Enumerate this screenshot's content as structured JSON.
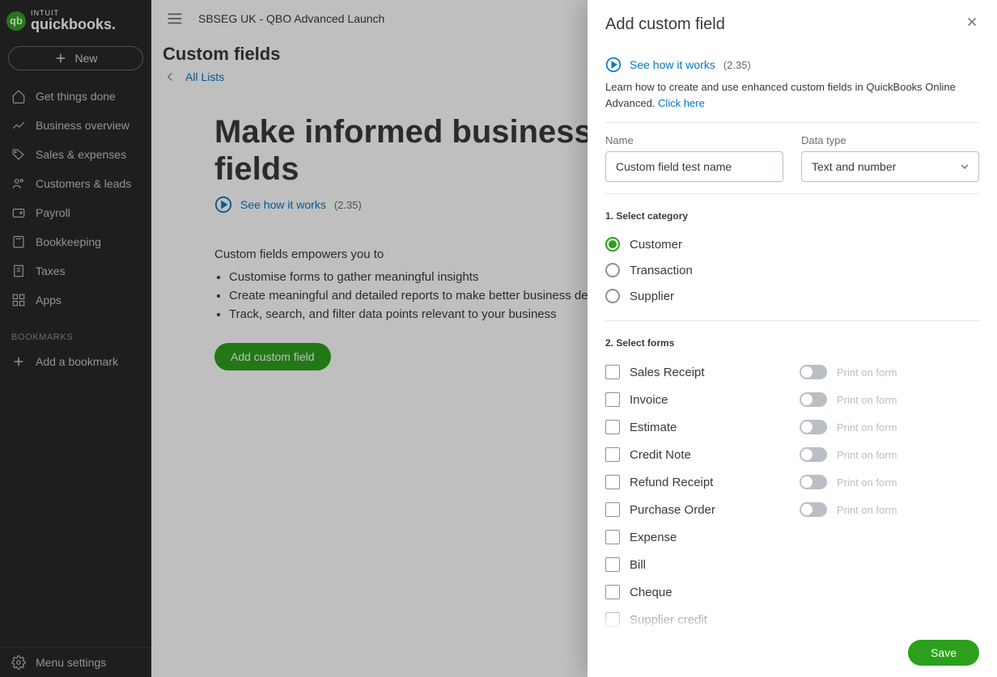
{
  "brand": {
    "intuit": "INTUIT",
    "product": "quickbooks."
  },
  "sidebar": {
    "new_label": "New",
    "items": [
      {
        "label": "Get things done",
        "icon": "home-icon"
      },
      {
        "label": "Business overview",
        "icon": "chart-icon"
      },
      {
        "label": "Sales & expenses",
        "icon": "tag-icon"
      },
      {
        "label": "Customers & leads",
        "icon": "people-icon"
      },
      {
        "label": "Payroll",
        "icon": "wallet-icon"
      },
      {
        "label": "Bookkeeping",
        "icon": "book-icon"
      },
      {
        "label": "Taxes",
        "icon": "receipt-icon"
      },
      {
        "label": "Apps",
        "icon": "grid-icon"
      }
    ],
    "bookmarks_label": "BOOKMARKS",
    "add_bookmark_label": "Add a bookmark",
    "menu_settings_label": "Menu settings"
  },
  "topbar": {
    "company": "SBSEG UK - QBO Advanced Launch"
  },
  "page": {
    "title": "Custom fields",
    "breadcrumb": "All Lists",
    "hero_title": "Make informed business decisions with custom fields",
    "see_how_label": "See how it works",
    "see_how_duration": "(2.35)",
    "desc_intro": "Custom fields empowers you to",
    "desc_items": [
      "Customise forms to gather meaningful insights",
      "Create meaningful and detailed reports to make better business decisions",
      "Track, search, and filter data points relevant to your business"
    ],
    "add_button_label": "Add custom field"
  },
  "drawer": {
    "title": "Add custom field",
    "see_how_label": "See how it works",
    "see_how_duration": "(2.35)",
    "help_text": "Learn how to create and use enhanced custom fields in QuickBooks Online Advanced. ",
    "help_link": "Click here",
    "name_label": "Name",
    "name_value": "Custom field test name",
    "data_type_label": "Data type",
    "data_type_value": "Text and number",
    "section_category": "1. Select category",
    "categories": [
      {
        "label": "Customer",
        "checked": true
      },
      {
        "label": "Transaction",
        "checked": false
      },
      {
        "label": "Supplier",
        "checked": false
      }
    ],
    "section_forms": "2. Select forms",
    "print_label": "Print on form",
    "forms": [
      {
        "label": "Sales Receipt",
        "has_print": true
      },
      {
        "label": "Invoice",
        "has_print": true
      },
      {
        "label": "Estimate",
        "has_print": true
      },
      {
        "label": "Credit Note",
        "has_print": true
      },
      {
        "label": "Refund Receipt",
        "has_print": true
      },
      {
        "label": "Purchase Order",
        "has_print": true
      },
      {
        "label": "Expense",
        "has_print": false
      },
      {
        "label": "Bill",
        "has_print": false
      },
      {
        "label": "Cheque",
        "has_print": false
      },
      {
        "label": "Supplier credit",
        "has_print": false
      }
    ],
    "save_label": "Save"
  }
}
